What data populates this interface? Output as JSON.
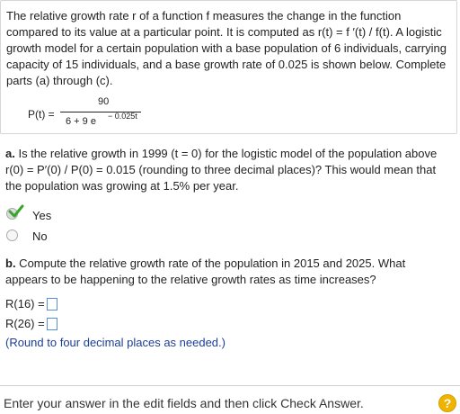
{
  "intro": {
    "text": "The relative growth rate r of a function f measures the change in the function compared to its value at a particular point. It is computed as r(t) = f ′(t) / f(t). A logistic growth model for a  certain population with a base population of 6 individuals, carrying capacity of 15 individuals, and a base growth rate of 0.025 is shown below. Complete parts (a) through (c)."
  },
  "formula": {
    "lhs": "P(t) =",
    "numerator": "90",
    "denominator": "6 + 9 e",
    "exponent": "− 0.025t"
  },
  "part_a": {
    "label": "a.",
    "question": " Is the relative growth in 1999 (t = 0) for the logistic model of the population above r(0) = P′(0) / P(0) = 0.015 (rounding to three decimal places)? This would mean that the population was growing at 1.5% per year.",
    "options": [
      {
        "label": "Yes",
        "selected": true
      },
      {
        "label": "No",
        "selected": false
      }
    ]
  },
  "part_b": {
    "label": "b.",
    "question": " Compute the relative growth rate of the population in 2015 and 2025. What appears to be happening to the relative growth rates as time increases?",
    "r16_label": "R(16) =",
    "r26_label": "R(26) =",
    "r16_value": "",
    "r26_value": "",
    "hint": "(Round to four decimal places as needed.)"
  },
  "footer": {
    "instruction": "Enter your answer in the edit fields and then click Check Answer.",
    "help_label": "?"
  },
  "colors": {
    "check": "#3aa52c",
    "hint": "#1c3f94",
    "help": "#f0b400",
    "input_border": "#5a8fd8"
  }
}
